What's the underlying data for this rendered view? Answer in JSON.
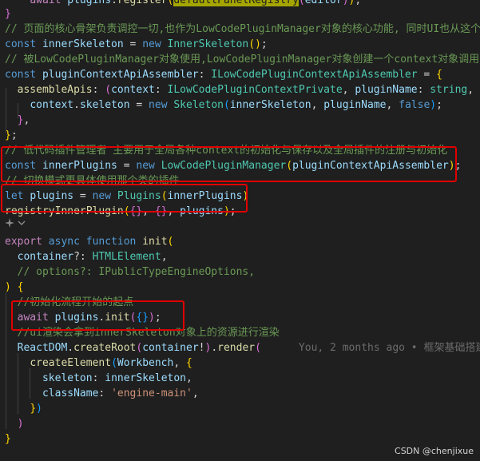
{
  "code_lines": [
    [
      [
        "    ",
        ""
      ],
      [
        "await",
        "c"
      ],
      [
        " ",
        ""
      ],
      [
        "plugins",
        "v"
      ],
      [
        ".",
        ""
      ],
      [
        "register",
        "f"
      ],
      [
        "(",
        "b1"
      ],
      [
        "defaultPanelRegistry",
        "sel"
      ],
      [
        "(",
        "b2"
      ],
      [
        "editor",
        "v"
      ],
      [
        ")",
        "b2"
      ],
      [
        ")",
        "b1"
      ],
      [
        ";",
        ""
      ]
    ],
    [
      [
        "}",
        "b2"
      ]
    ],
    [
      [
        "// 页面的核心骨架负责调控一切,也作为LowCodePluginManager对象的核心功能, 同时UI也从这个骨架输出",
        "m"
      ]
    ],
    [
      [
        "const",
        "k"
      ],
      [
        " ",
        ""
      ],
      [
        "innerSkeleton",
        "v"
      ],
      [
        " = ",
        ""
      ],
      [
        "new",
        "k"
      ],
      [
        " ",
        ""
      ],
      [
        "InnerSkeleton",
        "t"
      ],
      [
        "(",
        "b1"
      ],
      [
        ")",
        "b1"
      ],
      [
        ";",
        ""
      ]
    ],
    [
      [
        "// 被LowCodePluginManager对象使用,LowCodePluginManager对象创建一个context对象调用",
        "m"
      ]
    ],
    [
      [
        "const",
        "k"
      ],
      [
        " ",
        ""
      ],
      [
        "pluginContextApiAssembler",
        "v"
      ],
      [
        ": ",
        ""
      ],
      [
        "ILowCodePluginContextApiAssembler",
        "t"
      ],
      [
        " = ",
        ""
      ],
      [
        "{",
        "b1"
      ]
    ],
    [
      [
        "  ",
        ""
      ],
      [
        "assembleApis",
        "f"
      ],
      [
        ": ",
        ""
      ],
      [
        "(",
        "b2"
      ],
      [
        "context",
        "v"
      ],
      [
        ": ",
        ""
      ],
      [
        "ILowCodePluginContextPrivate",
        "t"
      ],
      [
        ", ",
        ""
      ],
      [
        "pluginName",
        "v"
      ],
      [
        ": ",
        ""
      ],
      [
        "string",
        "t"
      ],
      [
        ", ",
        ""
      ],
      [
        "meta",
        "v"
      ]
    ],
    [
      [
        "    ",
        ""
      ],
      [
        "context",
        "v"
      ],
      [
        ".",
        ""
      ],
      [
        "skeleton",
        "v"
      ],
      [
        " = ",
        ""
      ],
      [
        "new",
        "k"
      ],
      [
        " ",
        ""
      ],
      [
        "Skeleton",
        "t"
      ],
      [
        "(",
        "b3"
      ],
      [
        "innerSkeleton",
        "v"
      ],
      [
        ", ",
        ""
      ],
      [
        "pluginName",
        "v"
      ],
      [
        ", ",
        ""
      ],
      [
        "false",
        "k"
      ],
      [
        ")",
        "b3"
      ],
      [
        ";",
        ""
      ]
    ],
    [
      [
        "  ",
        ""
      ],
      [
        "}",
        "b2"
      ],
      [
        ",",
        ""
      ]
    ],
    [
      [
        "}",
        "b1"
      ],
      [
        ";",
        ""
      ]
    ],
    [
      [
        "// 低代码插件管理者 主要用于全局各种context的初始化与保存以及全局插件的注册与初始化",
        "m"
      ]
    ],
    [
      [
        "const",
        "k"
      ],
      [
        " ",
        ""
      ],
      [
        "innerPlugins",
        "v"
      ],
      [
        " = ",
        ""
      ],
      [
        "new",
        "k"
      ],
      [
        " ",
        ""
      ],
      [
        "LowCodePluginManager",
        "t"
      ],
      [
        "(",
        "b1"
      ],
      [
        "pluginContextApiAssembler",
        "v"
      ],
      [
        ")",
        "b1"
      ],
      [
        ";",
        ""
      ]
    ],
    [
      [
        "// 切换模式更具体使用那个类的插件",
        "m"
      ]
    ],
    [
      [
        "let",
        "k"
      ],
      [
        " ",
        ""
      ],
      [
        "plugins",
        "v"
      ],
      [
        " = ",
        ""
      ],
      [
        "new",
        "k"
      ],
      [
        " ",
        ""
      ],
      [
        "Plugins",
        "t"
      ],
      [
        "(",
        "b1"
      ],
      [
        "innerPlugins",
        "v"
      ],
      [
        ")",
        "b1"
      ]
    ],
    [
      [
        "registryInnerPlugin",
        "f"
      ],
      [
        "(",
        "b1"
      ],
      [
        "{}",
        "b2"
      ],
      [
        ", ",
        ""
      ],
      [
        "{}",
        "b2"
      ],
      [
        ", ",
        ""
      ],
      [
        "plugins",
        "v"
      ],
      [
        ")",
        "b1"
      ],
      [
        ";",
        ""
      ]
    ],
    [],
    [
      [
        "export",
        "c"
      ],
      [
        " ",
        ""
      ],
      [
        "async",
        "k"
      ],
      [
        " ",
        ""
      ],
      [
        "function",
        "k"
      ],
      [
        " ",
        ""
      ],
      [
        "init",
        "f"
      ],
      [
        "(",
        "b1"
      ]
    ],
    [
      [
        "  ",
        ""
      ],
      [
        "container",
        "v"
      ],
      [
        "?: ",
        ""
      ],
      [
        "HTMLElement",
        "t"
      ],
      [
        ",",
        ""
      ]
    ],
    [
      [
        "  ",
        ""
      ],
      [
        "// options?: IPublicTypeEngineOptions,",
        "m"
      ]
    ],
    [
      [
        ")",
        "b1"
      ],
      [
        " ",
        ""
      ],
      [
        "{",
        "b1"
      ]
    ],
    [
      [
        "  ",
        ""
      ],
      [
        "//初始化流程开始的起点",
        "m"
      ]
    ],
    [
      [
        "  ",
        ""
      ],
      [
        "await",
        "c"
      ],
      [
        " ",
        ""
      ],
      [
        "plugins",
        "v"
      ],
      [
        ".",
        ""
      ],
      [
        "init",
        "f"
      ],
      [
        "(",
        "b2"
      ],
      [
        "{}",
        "b3"
      ],
      [
        ")",
        "b2"
      ],
      [
        ";",
        ""
      ]
    ],
    [
      [
        "  ",
        ""
      ],
      [
        "//ui渲染会拿到innerSkeleton对象上的资源进行渲染",
        "m"
      ]
    ],
    [
      [
        "  ",
        ""
      ],
      [
        "ReactDOM",
        "v"
      ],
      [
        ".",
        ""
      ],
      [
        "createRoot",
        "f"
      ],
      [
        "(",
        "b2"
      ],
      [
        "container",
        "v"
      ],
      [
        "!",
        ""
      ],
      [
        ")",
        "b2"
      ],
      [
        ".",
        ""
      ],
      [
        "render",
        "f"
      ],
      [
        "(",
        "b2"
      ],
      [
        "      ",
        ""
      ],
      [
        "You, 2 months ago • 框架基础搭建",
        "blame"
      ]
    ],
    [
      [
        "    ",
        ""
      ],
      [
        "createElement",
        "f"
      ],
      [
        "(",
        "b3"
      ],
      [
        "Workbench",
        "v"
      ],
      [
        ", ",
        ""
      ],
      [
        "{",
        "b1"
      ]
    ],
    [
      [
        "      ",
        ""
      ],
      [
        "skeleton",
        "v"
      ],
      [
        ": ",
        ""
      ],
      [
        "innerSkeleton",
        "v"
      ],
      [
        ",",
        ""
      ]
    ],
    [
      [
        "      ",
        ""
      ],
      [
        "className",
        "v"
      ],
      [
        ": ",
        ""
      ],
      [
        "'engine-main'",
        "s"
      ],
      [
        ",",
        ""
      ]
    ],
    [
      [
        "    ",
        ""
      ],
      [
        "}",
        "b1"
      ],
      [
        ")",
        "b3"
      ]
    ],
    [
      [
        "  ",
        ""
      ],
      [
        ")",
        "b2"
      ]
    ],
    [
      [
        "}",
        "b1"
      ]
    ]
  ],
  "codelens": {
    "icon": "sparkle-icon",
    "chevron": "chevron-down-icon"
  },
  "watermark": "CSDN @chenjixue",
  "colors": {
    "background": "#1f1f1f",
    "highlight_box": "#e00000"
  }
}
